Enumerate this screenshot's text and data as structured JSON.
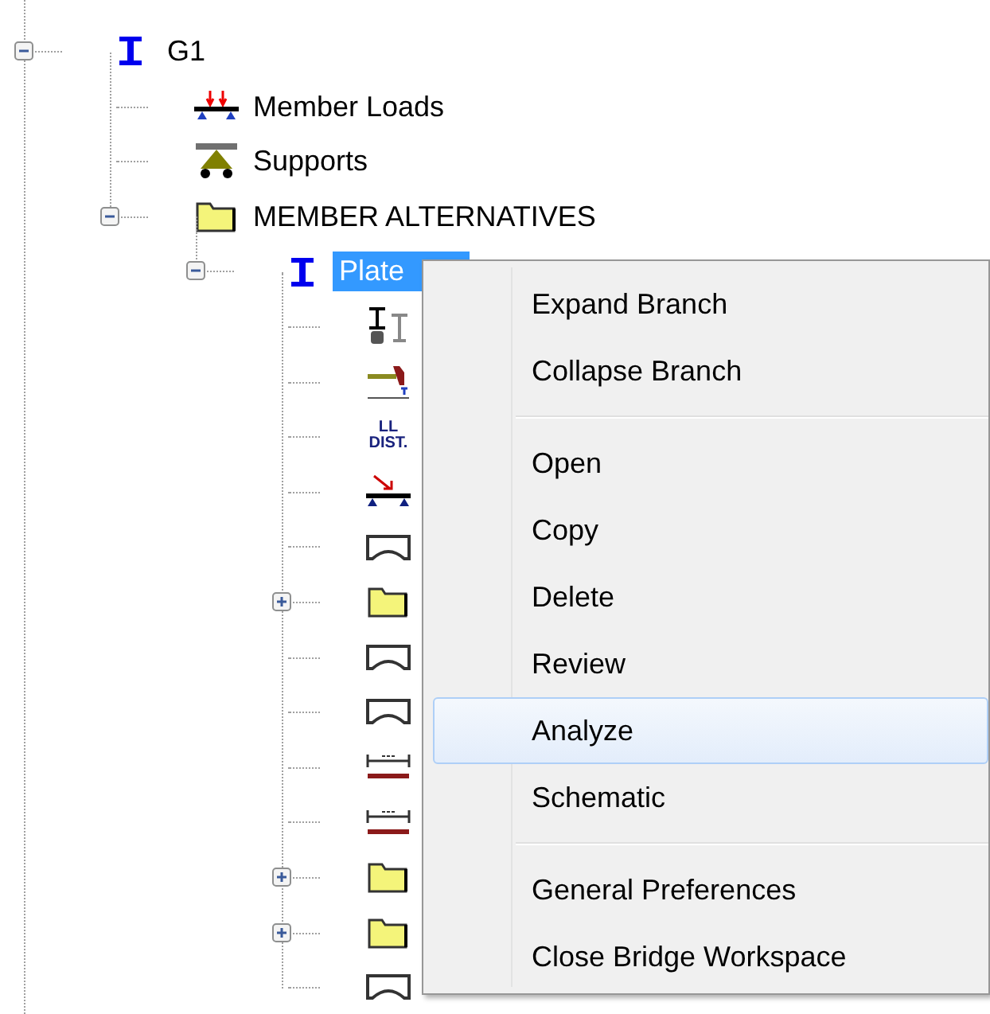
{
  "tree": [
    {
      "label": "G1",
      "kind": "ibeam",
      "expanded": true,
      "selected": false,
      "children": [
        {
          "label": "Member Loads",
          "kind": "member-loads",
          "selected": false
        },
        {
          "label": "Supports",
          "kind": "supports",
          "selected": false
        },
        {
          "label": "MEMBER ALTERNATIVES",
          "kind": "folder",
          "expanded": true,
          "selected": false,
          "children": [
            {
              "label": "Plate",
              "kind": "ibeam",
              "expanded": true,
              "selected": true,
              "children": [
                {
                  "kind": "sections",
                  "selected": false
                },
                {
                  "kind": "bracket",
                  "selected": false
                },
                {
                  "kind": "ll-dist",
                  "icon_text": [
                    "LL",
                    "DIST."
                  ],
                  "selected": false
                },
                {
                  "kind": "point-load",
                  "selected": false
                },
                {
                  "kind": "span",
                  "selected": false
                },
                {
                  "kind": "folder",
                  "expanded": false,
                  "selected": false
                },
                {
                  "kind": "span",
                  "selected": false
                },
                {
                  "kind": "span",
                  "selected": false
                },
                {
                  "kind": "dim-bar",
                  "selected": false
                },
                {
                  "kind": "dim-bar",
                  "selected": false
                },
                {
                  "kind": "folder",
                  "expanded": false,
                  "selected": false
                },
                {
                  "kind": "folder",
                  "expanded": false,
                  "selected": false
                },
                {
                  "kind": "span",
                  "selected": false
                }
              ]
            }
          ]
        }
      ]
    }
  ],
  "context_menu": {
    "groups": [
      [
        {
          "label": "Expand Branch",
          "highlighted": false
        },
        {
          "label": "Collapse Branch",
          "highlighted": false
        }
      ],
      [
        {
          "label": "Open",
          "highlighted": false
        },
        {
          "label": "Copy",
          "highlighted": false
        },
        {
          "label": "Delete",
          "highlighted": false
        },
        {
          "label": "Review",
          "highlighted": false
        },
        {
          "label": "Analyze",
          "highlighted": true
        },
        {
          "label": "Schematic",
          "highlighted": false
        }
      ],
      [
        {
          "label": "General Preferences",
          "highlighted": false
        },
        {
          "label": "Close Bridge Workspace",
          "highlighted": false
        }
      ]
    ]
  }
}
